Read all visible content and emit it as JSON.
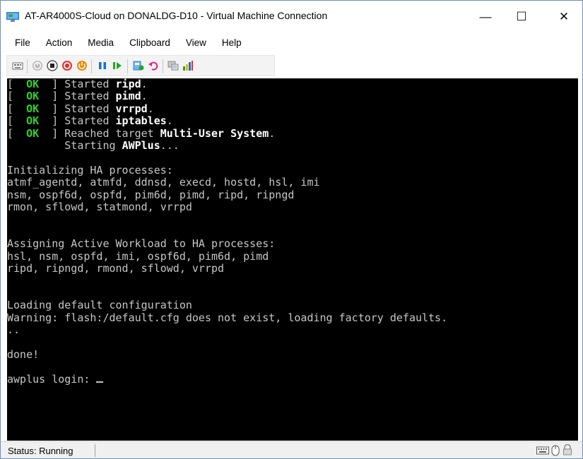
{
  "window": {
    "title": "AT-AR4000S-Cloud on DONALDG-D10 - Virtual Machine Connection",
    "minimize_glyph": "—",
    "maximize_glyph": "☐",
    "close_glyph": "✕"
  },
  "menu": {
    "items": [
      "File",
      "Action",
      "Media",
      "Clipboard",
      "View",
      "Help"
    ]
  },
  "toolbar": {
    "icons": [
      "ctrl-alt-del-icon",
      "start-icon",
      "turn-off-icon",
      "shut-down-icon",
      "power-icon",
      "pause-icon",
      "resume-icon",
      "checkpoint-icon",
      "revert-icon",
      "enhanced-session-icon",
      "zoom-icon"
    ]
  },
  "console": {
    "lines": [
      {
        "segments": [
          {
            "t": "[  ",
            "c": "n"
          },
          {
            "t": "OK",
            "c": "ok"
          },
          {
            "t": "  ] Started ",
            "c": "n"
          },
          {
            "t": "ripd",
            "c": "b"
          },
          {
            "t": ".",
            "c": "n"
          }
        ]
      },
      {
        "segments": [
          {
            "t": "[  ",
            "c": "n"
          },
          {
            "t": "OK",
            "c": "ok"
          },
          {
            "t": "  ] Started ",
            "c": "n"
          },
          {
            "t": "pimd",
            "c": "b"
          },
          {
            "t": ".",
            "c": "n"
          }
        ]
      },
      {
        "segments": [
          {
            "t": "[  ",
            "c": "n"
          },
          {
            "t": "OK",
            "c": "ok"
          },
          {
            "t": "  ] Started ",
            "c": "n"
          },
          {
            "t": "vrrpd",
            "c": "b"
          },
          {
            "t": ".",
            "c": "n"
          }
        ]
      },
      {
        "segments": [
          {
            "t": "[  ",
            "c": "n"
          },
          {
            "t": "OK",
            "c": "ok"
          },
          {
            "t": "  ] Started ",
            "c": "n"
          },
          {
            "t": "iptables",
            "c": "b"
          },
          {
            "t": ".",
            "c": "n"
          }
        ]
      },
      {
        "segments": [
          {
            "t": "[  ",
            "c": "n"
          },
          {
            "t": "OK",
            "c": "ok"
          },
          {
            "t": "  ] Reached target ",
            "c": "n"
          },
          {
            "t": "Multi-User System",
            "c": "b"
          },
          {
            "t": ".",
            "c": "n"
          }
        ]
      },
      {
        "segments": [
          {
            "t": "         Starting ",
            "c": "n"
          },
          {
            "t": "AWPlus",
            "c": "b"
          },
          {
            "t": "...",
            "c": "n"
          }
        ]
      },
      {
        "segments": []
      },
      {
        "segments": [
          {
            "t": "Initializing HA processes:",
            "c": "n"
          }
        ]
      },
      {
        "segments": [
          {
            "t": "atmf_agentd, atmfd, ddnsd, execd, hostd, hsl, imi",
            "c": "n"
          }
        ]
      },
      {
        "segments": [
          {
            "t": "nsm, ospf6d, ospfd, pim6d, pimd, ripd, ripngd",
            "c": "n"
          }
        ]
      },
      {
        "segments": [
          {
            "t": "rmon, sflowd, statmond, vrrpd",
            "c": "n"
          }
        ]
      },
      {
        "segments": []
      },
      {
        "segments": []
      },
      {
        "segments": [
          {
            "t": "Assigning Active Workload to HA processes:",
            "c": "n"
          }
        ]
      },
      {
        "segments": [
          {
            "t": "hsl, nsm, ospfd, imi, ospf6d, pim6d, pimd",
            "c": "n"
          }
        ]
      },
      {
        "segments": [
          {
            "t": "ripd, ripngd, rmond, sflowd, vrrpd",
            "c": "n"
          }
        ]
      },
      {
        "segments": []
      },
      {
        "segments": []
      },
      {
        "segments": [
          {
            "t": "Loading default configuration",
            "c": "n"
          }
        ]
      },
      {
        "segments": [
          {
            "t": "Warning: flash:/default.cfg does not exist, loading factory defaults.",
            "c": "n"
          }
        ]
      },
      {
        "segments": [
          {
            "t": "..",
            "c": "n"
          }
        ]
      },
      {
        "segments": []
      },
      {
        "segments": [
          {
            "t": "done!",
            "c": "n"
          }
        ]
      },
      {
        "segments": []
      },
      {
        "segments": [
          {
            "t": "awplus login: ",
            "c": "n"
          }
        ],
        "cursor": true
      }
    ]
  },
  "status": {
    "text": "Status: Running",
    "icons": [
      "keyboard-icon",
      "mouse-icon",
      "lock-icon"
    ]
  },
  "colors": {
    "console_bg": "#000000",
    "console_fg": "#c6c6c6",
    "ok_green": "#2fd12f",
    "bright": "#ffffff"
  }
}
